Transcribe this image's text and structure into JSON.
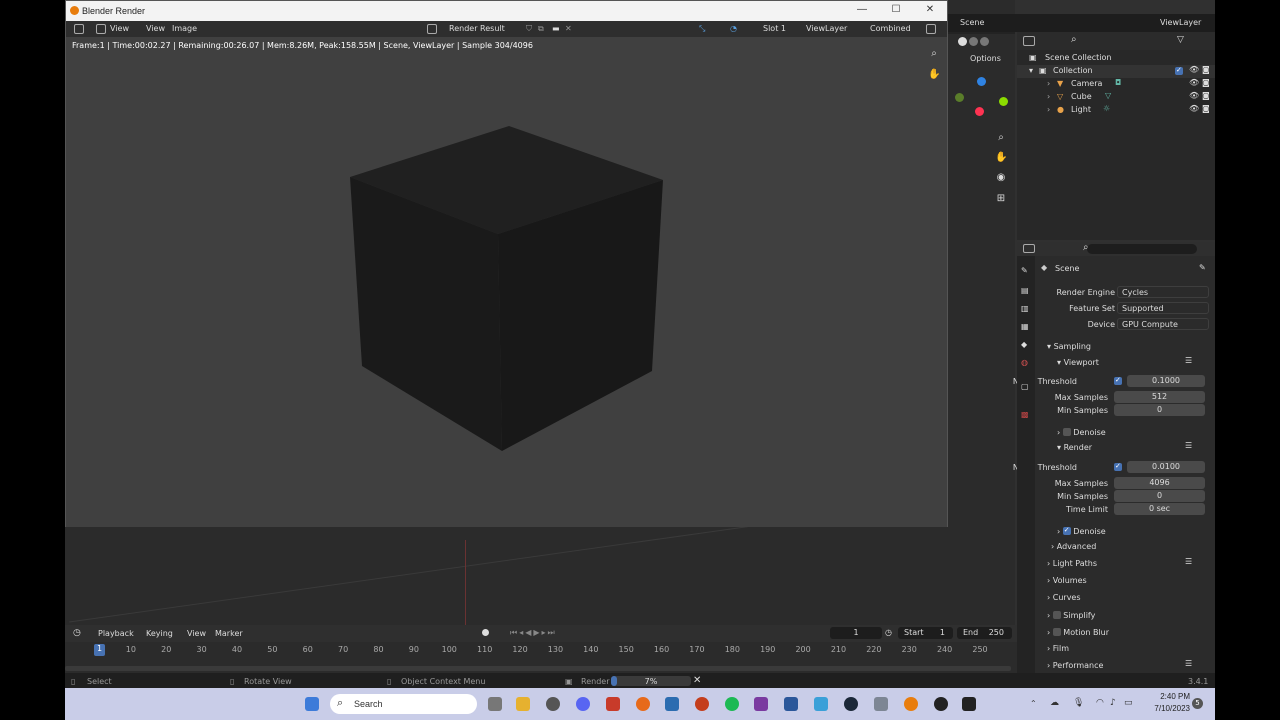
{
  "render_window": {
    "title": "Blender Render",
    "menu": {
      "view1": "View",
      "view2": "View",
      "image": "Image"
    },
    "image_name": "Render Result",
    "slot": "Slot 1",
    "view_layer": "ViewLayer",
    "pass": "Combined",
    "status": "Frame:1 | Time:00:02.27 | Remaining:00:26.07 | Mem:8.26M, Peak:158.55M | Scene, ViewLayer | Sample 304/4096"
  },
  "top_bar": {
    "scene": "Scene",
    "view_layer": "ViewLayer"
  },
  "viewport": {
    "options": "Options"
  },
  "outliner": {
    "rows": [
      {
        "label": "Scene Collection"
      },
      {
        "label": "Collection"
      },
      {
        "label": "Camera"
      },
      {
        "label": "Cube"
      },
      {
        "label": "Light"
      }
    ]
  },
  "properties": {
    "scene": "Scene",
    "render_engine_label": "Render Engine",
    "render_engine": "Cycles",
    "feature_set_label": "Feature Set",
    "feature_set": "Supported",
    "device_label": "Device",
    "device": "GPU Compute",
    "sampling": "Sampling",
    "viewport": "Viewport",
    "vp_noise_label": "Noise Threshold",
    "vp_noise": "0.1000",
    "vp_max_label": "Max Samples",
    "vp_max": "512",
    "vp_min_label": "Min Samples",
    "vp_min": "0",
    "vp_denoise": "Denoise",
    "render": "Render",
    "r_noise_label": "Noise Threshold",
    "r_noise": "0.0100",
    "r_max_label": "Max Samples",
    "r_max": "4096",
    "r_min_label": "Min Samples",
    "r_min": "0",
    "r_time_label": "Time Limit",
    "r_time": "0 sec",
    "r_denoise": "Denoise",
    "advanced": "Advanced",
    "light_paths": "Light Paths",
    "volumes": "Volumes",
    "curves": "Curves",
    "simplify": "Simplify",
    "motion_blur": "Motion Blur",
    "film": "Film",
    "performance": "Performance"
  },
  "timeline": {
    "playback": "Playback",
    "keying": "Keying",
    "view": "View",
    "marker": "Marker",
    "current_frame": "1",
    "start_label": "Start",
    "start": "1",
    "end_label": "End",
    "end": "250",
    "ticks": [
      "1",
      "10",
      "20",
      "30",
      "40",
      "50",
      "60",
      "70",
      "80",
      "90",
      "100",
      "110",
      "120",
      "130",
      "140",
      "150",
      "160",
      "170",
      "180",
      "190",
      "200",
      "210",
      "220",
      "230",
      "240",
      "250"
    ]
  },
  "status_bar": {
    "select": "Select",
    "rotate": "Rotate View",
    "context": "Object Context Menu",
    "render_label": "Render",
    "render_progress": "7%",
    "render_progress_value": 0.07,
    "version": "3.4.1"
  },
  "taskbar": {
    "search_placeholder": "Search",
    "time": "2:40 PM",
    "date": "7/10/2023",
    "notification_count": "5"
  }
}
